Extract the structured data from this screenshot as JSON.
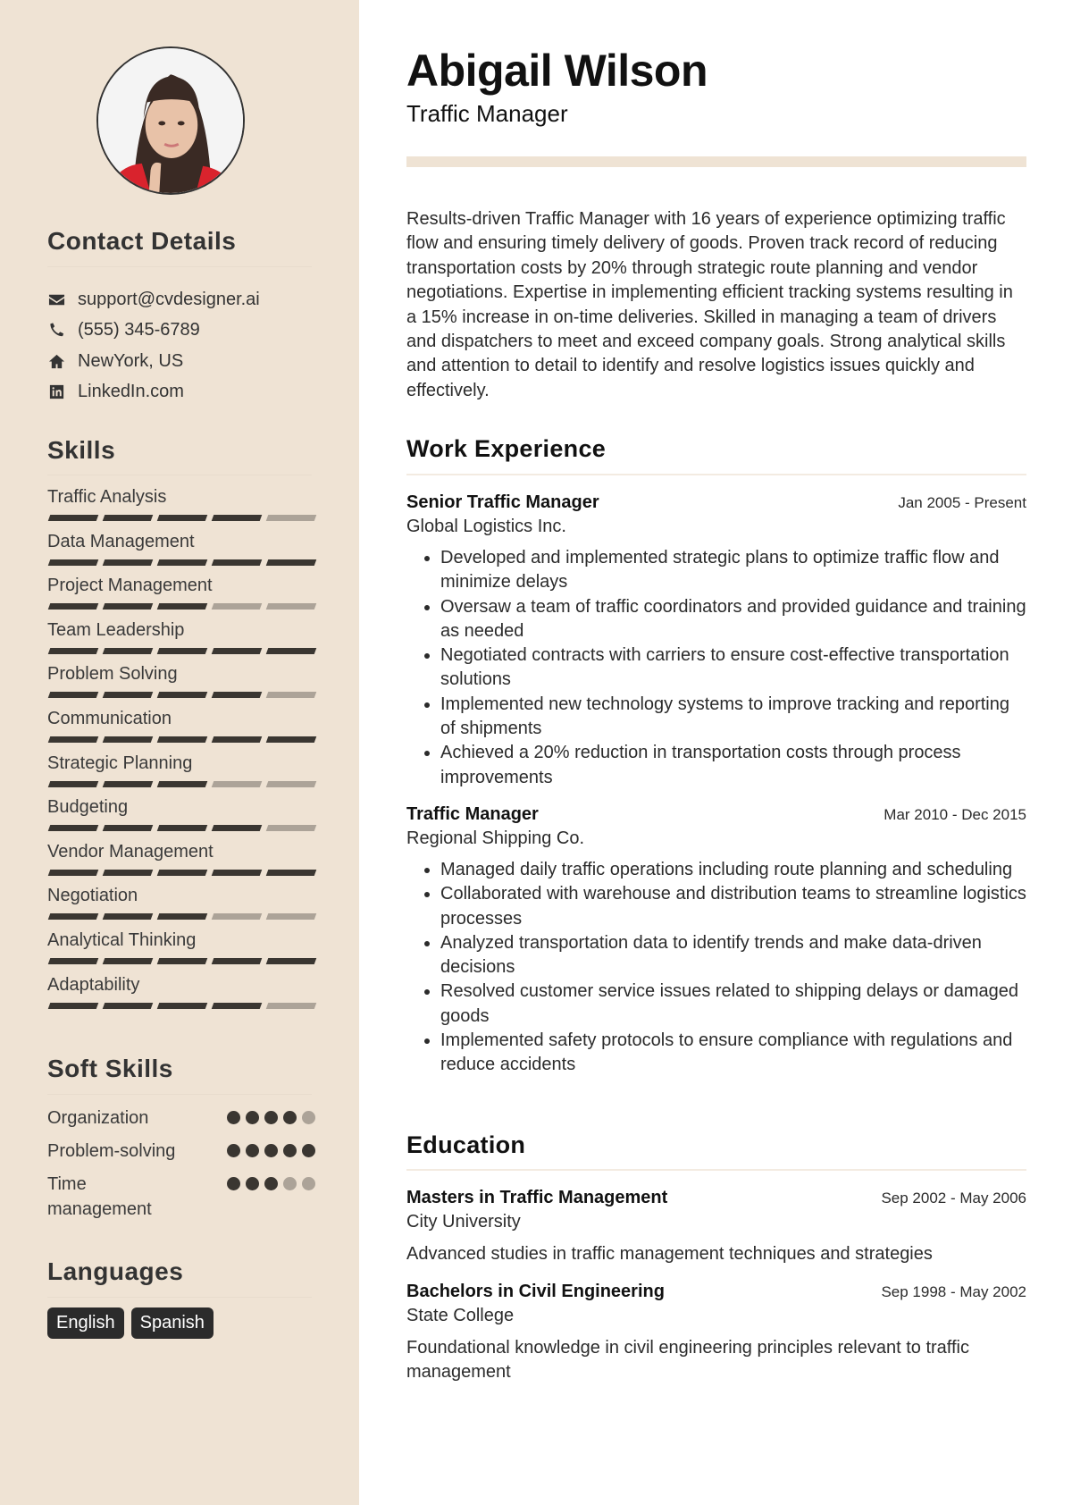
{
  "sidebar": {
    "contact_heading": "Contact Details",
    "contacts": [
      {
        "icon": "envelope-icon",
        "text": "support@cvdesigner.ai"
      },
      {
        "icon": "phone-icon",
        "text": "(555) 345-6789"
      },
      {
        "icon": "home-icon",
        "text": "NewYork, US"
      },
      {
        "icon": "linkedin-icon",
        "text": "LinkedIn.com"
      }
    ],
    "skills_heading": "Skills",
    "skills": [
      {
        "name": "Traffic Analysis",
        "level": 4,
        "max": 5
      },
      {
        "name": "Data Management",
        "level": 5,
        "max": 5
      },
      {
        "name": "Project Management",
        "level": 3,
        "max": 5
      },
      {
        "name": "Team Leadership",
        "level": 5,
        "max": 5
      },
      {
        "name": "Problem Solving",
        "level": 4,
        "max": 5
      },
      {
        "name": "Communication",
        "level": 5,
        "max": 5
      },
      {
        "name": "Strategic Planning",
        "level": 3,
        "max": 5
      },
      {
        "name": "Budgeting",
        "level": 4,
        "max": 5
      },
      {
        "name": "Vendor Management",
        "level": 5,
        "max": 5
      },
      {
        "name": "Negotiation",
        "level": 3,
        "max": 5
      },
      {
        "name": "Analytical Thinking",
        "level": 5,
        "max": 5
      },
      {
        "name": "Adaptability",
        "level": 4,
        "max": 5
      }
    ],
    "soft_heading": "Soft Skills",
    "soft_skills": [
      {
        "name": "Organization",
        "level": 4,
        "max": 5
      },
      {
        "name": "Problem-solving",
        "level": 5,
        "max": 5
      },
      {
        "name": "Time management",
        "level": 3,
        "max": 5
      }
    ],
    "languages_heading": "Languages",
    "languages": [
      "English",
      "Spanish"
    ]
  },
  "header": {
    "name": "Abigail Wilson",
    "title": "Traffic Manager"
  },
  "summary": "Results-driven Traffic Manager with 16 years of experience optimizing traffic flow and ensuring timely delivery of goods. Proven track record of reducing transportation costs by 20% through strategic route planning and vendor negotiations. Expertise in implementing efficient tracking systems resulting in a 15% increase in on-time deliveries. Skilled in managing a team of drivers and dispatchers to meet and exceed company goals. Strong analytical skills and attention to detail to identify and resolve logistics issues quickly and effectively.",
  "work": {
    "heading": "Work Experience",
    "jobs": [
      {
        "title": "Senior Traffic Manager",
        "dates": "Jan 2005 - Present",
        "company": "Global Logistics Inc.",
        "bullets": [
          "Developed and implemented strategic plans to optimize traffic flow and minimize delays",
          "Oversaw a team of traffic coordinators and provided guidance and training as needed",
          "Negotiated contracts with carriers to ensure cost-effective transportation solutions",
          "Implemented new technology systems to improve tracking and reporting of shipments",
          "Achieved a 20% reduction in transportation costs through process improvements"
        ]
      },
      {
        "title": "Traffic Manager",
        "dates": "Mar 2010 - Dec 2015",
        "company": "Regional Shipping Co.",
        "bullets": [
          "Managed daily traffic operations including route planning and scheduling",
          "Collaborated with warehouse and distribution teams to streamline logistics processes",
          "Analyzed transportation data to identify trends and make data-driven decisions",
          "Resolved customer service issues related to shipping delays or damaged goods",
          "Implemented safety protocols to ensure compliance with regulations and reduce accidents"
        ]
      }
    ]
  },
  "education": {
    "heading": "Education",
    "items": [
      {
        "degree": "Masters in Traffic Management",
        "dates": "Sep 2002 - May 2006",
        "school": "City University",
        "description": "Advanced studies in traffic management techniques and strategies"
      },
      {
        "degree": "Bachelors in Civil Engineering",
        "dates": "Sep 1998 - May 2002",
        "school": "State College",
        "description": "Foundational knowledge in civil engineering principles relevant to traffic management"
      }
    ]
  }
}
